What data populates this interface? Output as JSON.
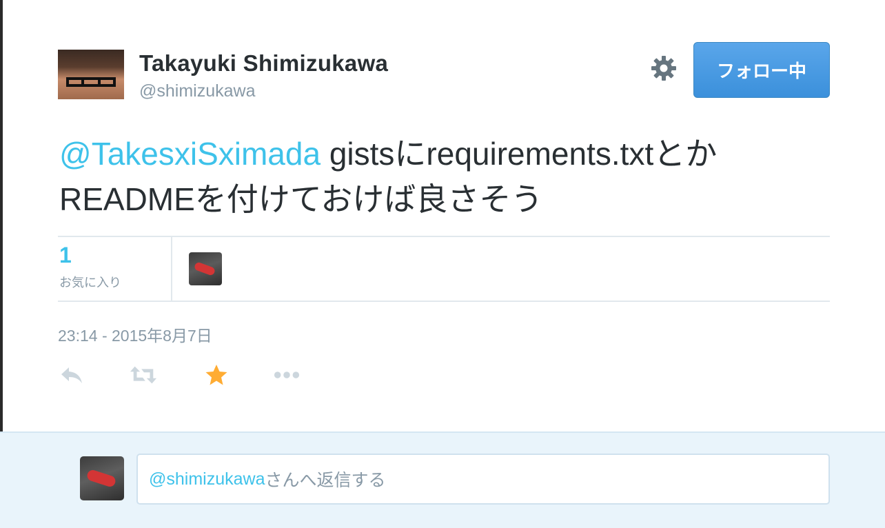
{
  "tweet": {
    "fullname": "Takayuki Shimizukawa",
    "handle": "@shimizukawa",
    "follow_label": "フォロー中",
    "text_mention": "@TakesxiSximada",
    "text_rest": " gistsにrequirements.txtとかREADMEを付けておけば良さそう",
    "favorite_count": "1",
    "favorite_label": "お気に入り",
    "timestamp": "23:14 - 2015年8月7日"
  },
  "actions": [
    {
      "name": "reply-icon",
      "color": "#ccd6dd"
    },
    {
      "name": "retweet-icon",
      "color": "#ccd6dd"
    },
    {
      "name": "favorite-star-icon",
      "color": "#ffac33"
    },
    {
      "name": "more-icon",
      "color": "#ccd6dd"
    }
  ],
  "reply": {
    "mention": "@shimizukawa",
    "placeholder_rest": "さんへ返信する"
  },
  "colors": {
    "mention": "#3ec2ea",
    "follow_button": "#4a9ee3",
    "text": "#292f33",
    "muted": "#8899a6",
    "favorited": "#ffac33"
  }
}
